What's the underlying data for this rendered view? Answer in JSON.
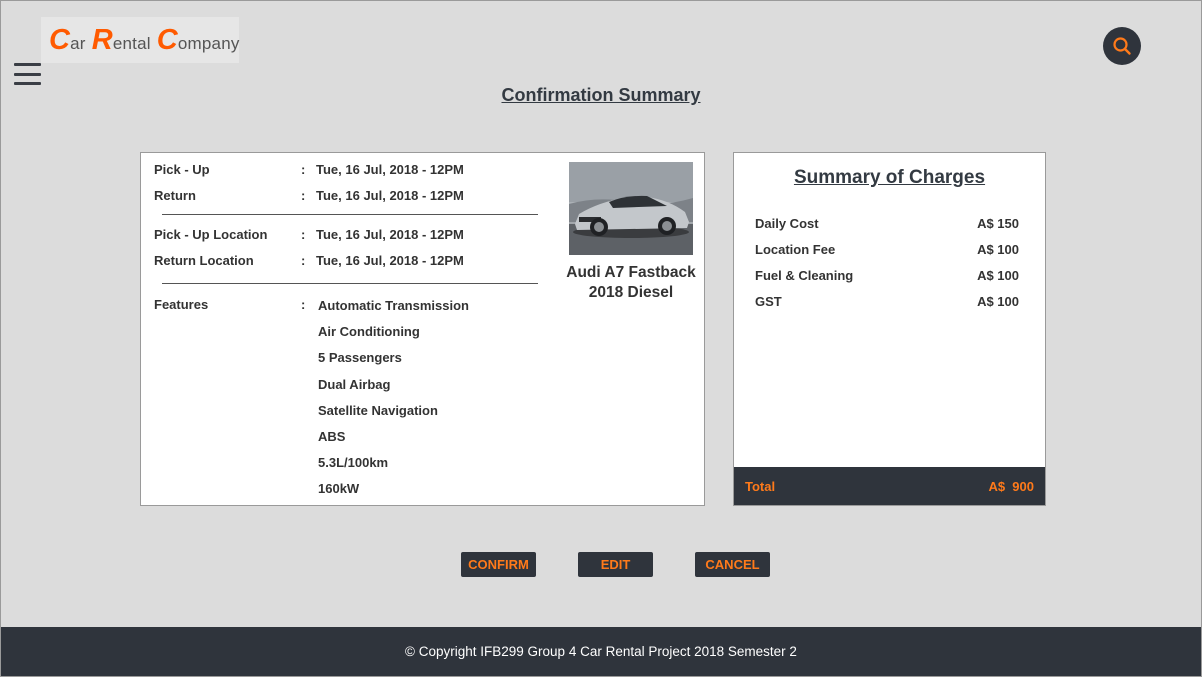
{
  "brand": {
    "words": [
      {
        "cap": "C",
        "rest": "ar"
      },
      {
        "cap": "R",
        "rest": "ental"
      },
      {
        "cap": "C",
        "rest": "ompany"
      }
    ]
  },
  "icons": {
    "menu": "hamburger-menu-icon",
    "search": "search-icon"
  },
  "colors": {
    "accent": "#ff7a1a",
    "dark": "#2f343c",
    "background": "#dcdcdc"
  },
  "page_title": "Confirmation Summary",
  "details": {
    "colon": ":",
    "pickup": {
      "label": "Pick - Up",
      "value": "Tue, 16 Jul, 2018 - 12PM"
    },
    "return": {
      "label": "Return",
      "value": "Tue, 16 Jul, 2018 - 12PM"
    },
    "pickup_location": {
      "label": "Pick - Up Location",
      "value": "Tue, 16 Jul, 2018 - 12PM"
    },
    "return_location": {
      "label": "Return Location",
      "value": "Tue, 16 Jul, 2018 - 12PM"
    },
    "features_label": "Features",
    "features": [
      "Automatic Transmission",
      "Air Conditioning",
      "5 Passengers",
      "Dual Airbag",
      "Satellite Navigation",
      "ABS",
      "5.3L/100km",
      "160kW"
    ]
  },
  "car": {
    "name_line1": "Audi A7 Fastback",
    "name_line2": "2018 Diesel"
  },
  "charges": {
    "title": "Summary of Charges",
    "items": [
      {
        "name": "Daily Cost",
        "amount": "A$ 150"
      },
      {
        "name": "Location Fee",
        "amount": "A$ 100"
      },
      {
        "name": "Fuel & Cleaning",
        "amount": "A$ 100"
      },
      {
        "name": "GST",
        "amount": "A$ 100"
      }
    ],
    "total_label": "Total",
    "total_amount": "A$  900"
  },
  "actions": {
    "confirm": "CONFIRM",
    "edit": "EDIT",
    "cancel": "CANCEL"
  },
  "footer": "© Copyright IFB299 Group 4 Car Rental Project 2018 Semester 2"
}
